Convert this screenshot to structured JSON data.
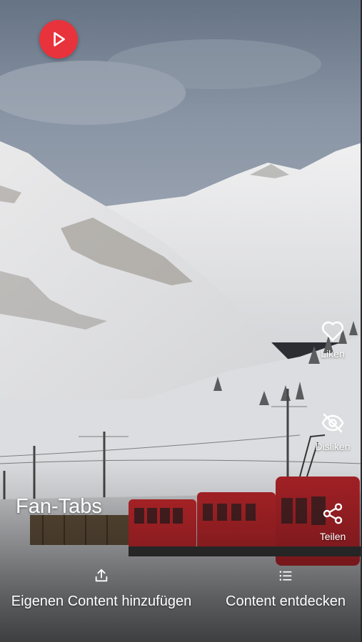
{
  "title": "Fan-Tabs",
  "play_button": {
    "icon": "play-icon"
  },
  "actions": [
    {
      "label": "Liken",
      "icon": "heart-icon"
    },
    {
      "label": "Disliken",
      "icon": "eye-off-icon"
    },
    {
      "label": "Teilen",
      "icon": "share-icon"
    }
  ],
  "bottom": {
    "add_content": {
      "label": "Eigenen Content hinzufügen",
      "icon": "upload-icon"
    },
    "discover": {
      "label": "Content entdecken",
      "icon": "list-icon"
    }
  },
  "colors": {
    "accent": "#e8333d",
    "text": "#ffffff",
    "train": "#b8262a"
  }
}
